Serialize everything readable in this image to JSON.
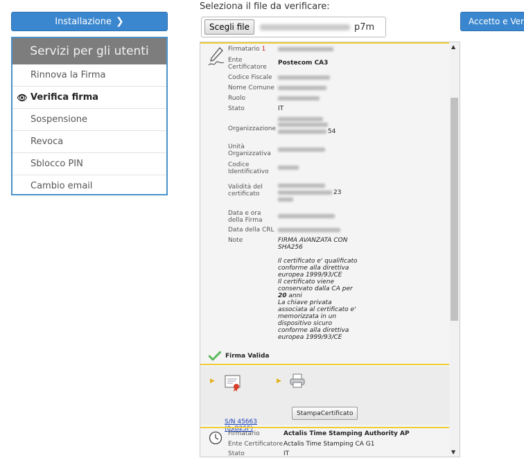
{
  "sidebar": {
    "install_label": "Installazione",
    "services_title": "Servizi per gli utenti",
    "items": [
      {
        "label": "Rinnova la Firma"
      },
      {
        "label": "Verifica firma"
      },
      {
        "label": "Sospensione"
      },
      {
        "label": "Revoca"
      },
      {
        "label": "Sblocco PIN"
      },
      {
        "label": "Cambio email"
      }
    ]
  },
  "file": {
    "prompt": "Seleziona il file da verificare:",
    "choose_label": "Scegli file",
    "extension": "p7m"
  },
  "accept_label": "Accetto e Veri",
  "signature": {
    "firmatario_label": "Firmatario",
    "firmatario_marker": "1",
    "ente_label": "Ente Certificatore",
    "ente_value": "Postecom CA3",
    "codice_fiscale_label": "Codice Fiscale",
    "nome_comune_label": "Nome Comune",
    "ruolo_label": "Ruolo",
    "stato_label": "Stato",
    "stato_value": "IT",
    "organizzazione_label": "Organizzazione",
    "organizzazione_tail": "54",
    "unita_label": "Unità Organizzativa",
    "codice_id_label": "Codice Identificativo",
    "validita_label": "Validità del certificato",
    "validita_tail": "23",
    "data_firma_label": "Data e ora della Firma",
    "data_crl_label": "Data della CRL",
    "note_label": "Note",
    "note_lines": [
      "FIRMA AVANZATA CON SHA256",
      "Il certificato e' qualificato conforme alla direttiva europea 1999/93/CE",
      "Il certificato viene conservato dalla CA per",
      "20",
      "anni",
      "La chiave privata associata al certificato e' memorizzata in un dispositivo sicuro conforme alla direttiva europea 1999/93/CE"
    ],
    "valid_label": "Firma Valida",
    "serial_line1": "S/N 45663",
    "serial_line2": "(0xB25F)",
    "print_label": "StampaCertificato"
  },
  "timestamp": {
    "firmatario_label": "Firmatario",
    "firmatario_value": "Actalis Time Stamping Authority AP",
    "ente_label": "Ente Certificatore",
    "ente_value": "Actalis Time Stamping CA G1",
    "stato_label": "Stato",
    "stato_value": "IT"
  },
  "colors": {
    "primary_button": "#3a87cf",
    "services_header": "#7d7d7d",
    "highlight_bar": "#f0cc35",
    "valid_check": "#5cb85c",
    "link": "#1a3fb6"
  },
  "icons": {
    "install": "chevron-right-icon",
    "active_item": "eye-icon",
    "signature": "pen-signature-icon",
    "valid": "checkmark-icon",
    "certificate": "certificate-icon",
    "printer": "printer-icon",
    "timestamp": "clock-icon"
  }
}
